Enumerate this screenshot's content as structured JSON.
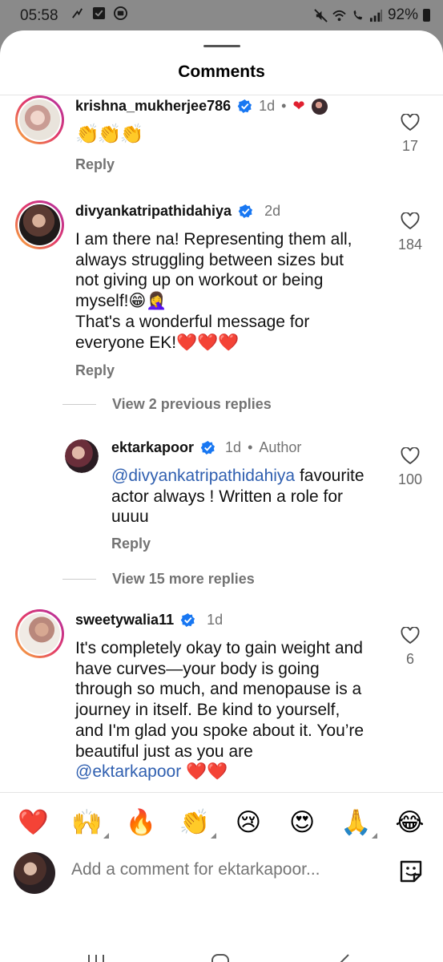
{
  "status": {
    "time": "05:58",
    "battery": "92%"
  },
  "sheet": {
    "title": "Comments"
  },
  "comments": [
    {
      "username": "krishna_mukherjee786",
      "age": "1d",
      "dot": "•",
      "reactions": "❤",
      "text": "👏👏👏",
      "reply_label": "Reply",
      "likes": "17"
    },
    {
      "username": "divyankatripathidahiya",
      "age": "2d",
      "text_lines": [
        "I am there na! Representing them all,",
        "always struggling between sizes but",
        "not giving up on workout or being",
        "myself!😁🤦‍♀️",
        "That's a wonderful message for",
        "everyone EK!❤️❤️❤️"
      ],
      "reply_label": "Reply",
      "likes": "184"
    }
  ],
  "view_previous_replies": "View 2 previous replies",
  "reply": {
    "username": "ektarkapoor",
    "age": "1d",
    "dot": "•",
    "role": "Author",
    "mention": "@divyankatripathidahiya",
    "text_line1_rest": " favourite",
    "text_line2": "actor always ! Written a role for",
    "text_line3": "uuuu",
    "reply_label": "Reply",
    "likes": "100"
  },
  "view_more_replies": "View 15 more replies",
  "comment3": {
    "username": "sweetywalia11",
    "age": "1d",
    "text_lines": [
      "It's completely okay to gain weight and",
      "have curves—your body is going",
      "through so much, and menopause is a",
      "journey in itself. Be kind to yourself,",
      "and I'm glad you spoke about it. You’re",
      "beautiful just as you are"
    ],
    "mention": "@ektarkapoor",
    "hearts": "❤️❤️",
    "likes": "6"
  },
  "emoji_bar": [
    "❤️",
    "🙌",
    "🔥",
    "👏",
    "😢",
    "😍",
    "🙏",
    "😂"
  ],
  "composer": {
    "placeholder": "Add a comment for ektarkapoor..."
  },
  "colors": {
    "accent_link": "#2f5fb0",
    "verified": "#1877f2",
    "meta_gray": "#737373"
  }
}
